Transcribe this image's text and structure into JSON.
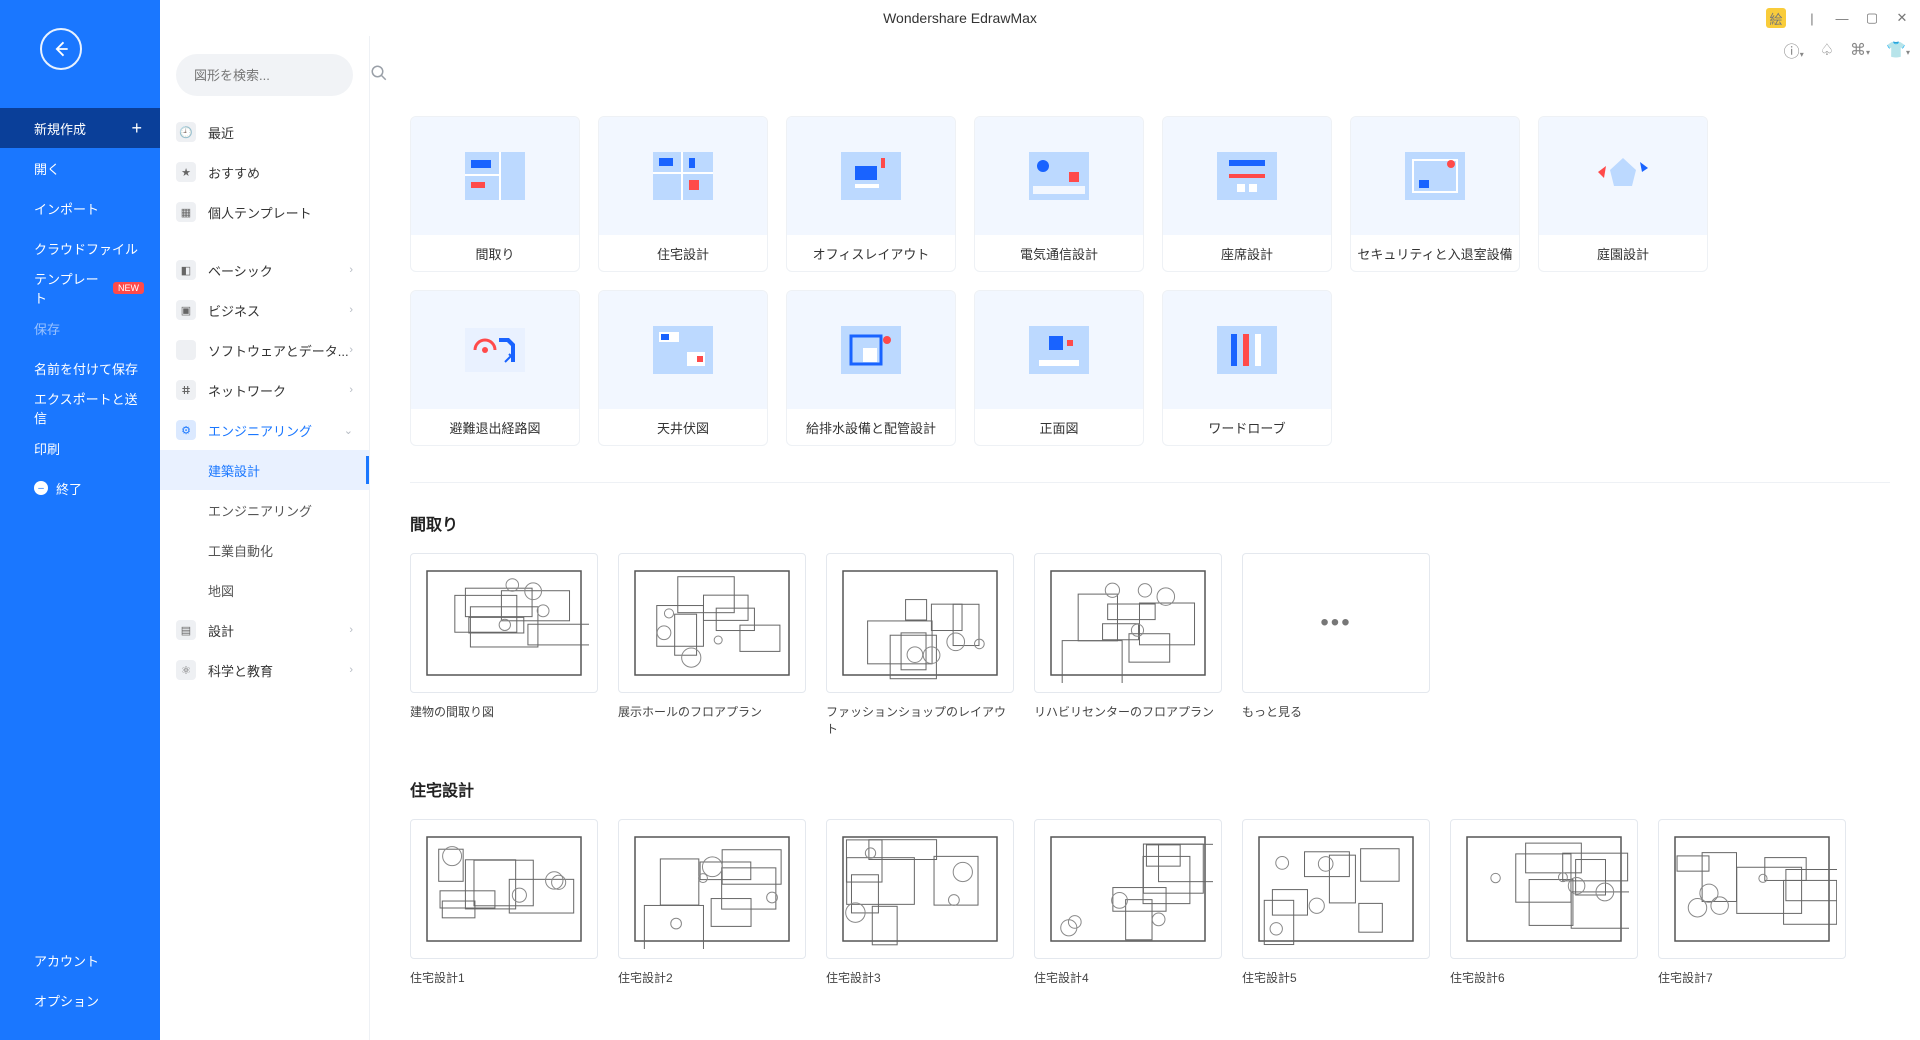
{
  "app": {
    "title": "Wondershare EdrawMax",
    "avatar_text": "絵"
  },
  "rail": {
    "items": [
      {
        "label": "新規作成",
        "active": true,
        "plus": true
      },
      {
        "label": "開く"
      },
      {
        "label": "インポート"
      },
      {
        "label": "クラウドファイル"
      },
      {
        "label": "テンプレート",
        "badge": "NEW"
      },
      {
        "label": "保存",
        "dim": true
      },
      {
        "label": "名前を付けて保存"
      },
      {
        "label": "エクスポートと送信"
      },
      {
        "label": "印刷"
      },
      {
        "label": "終了",
        "icon": "minus"
      }
    ],
    "bottom": [
      {
        "label": "アカウント"
      },
      {
        "label": "オプション"
      }
    ]
  },
  "search": {
    "placeholder": "図形を検索..."
  },
  "categories": {
    "top": [
      {
        "label": "最近",
        "icon": "clock"
      },
      {
        "label": "おすすめ",
        "icon": "star"
      },
      {
        "label": "個人テンプレート",
        "icon": "tpl"
      }
    ],
    "groups": [
      {
        "label": "ベーシック",
        "icon": "cube"
      },
      {
        "label": "ビジネス",
        "icon": "biz"
      },
      {
        "label": "ソフトウェアとデータ...",
        "icon": "code"
      },
      {
        "label": "ネットワーク",
        "icon": "net"
      },
      {
        "label": "エンジニアリング",
        "icon": "eng",
        "expanded": true,
        "blue": true,
        "subs": [
          {
            "label": "建築設計",
            "active": true
          },
          {
            "label": "エンジニアリング"
          },
          {
            "label": "工業自動化"
          },
          {
            "label": "地図"
          }
        ]
      },
      {
        "label": "設計",
        "icon": "des"
      },
      {
        "label": "科学と教育",
        "icon": "sci"
      }
    ]
  },
  "tiles": [
    {
      "label": "間取り"
    },
    {
      "label": "住宅設計"
    },
    {
      "label": "オフィスレイアウト"
    },
    {
      "label": "電気通信設計"
    },
    {
      "label": "座席設計"
    },
    {
      "label": "セキュリティと入退室設備"
    },
    {
      "label": "庭園設計"
    },
    {
      "label": "避難退出経路図"
    },
    {
      "label": "天井伏図"
    },
    {
      "label": "給排水設備と配管設計"
    },
    {
      "label": "正面図"
    },
    {
      "label": "ワードローブ"
    }
  ],
  "sections": [
    {
      "title": "間取り",
      "templates": [
        {
          "label": "建物の間取り図"
        },
        {
          "label": "展示ホールのフロアプラン"
        },
        {
          "label": "ファッションショップのレイアウト"
        },
        {
          "label": "リハビリセンターのフロアプラン"
        },
        {
          "label": "もっと見る",
          "more": true
        }
      ]
    },
    {
      "title": "住宅設計",
      "templates": [
        {
          "label": "住宅設計1"
        },
        {
          "label": "住宅設計2"
        },
        {
          "label": "住宅設計3"
        },
        {
          "label": "住宅設計4"
        },
        {
          "label": "住宅設計5"
        },
        {
          "label": "住宅設計6"
        },
        {
          "label": "住宅設計7"
        }
      ]
    }
  ]
}
